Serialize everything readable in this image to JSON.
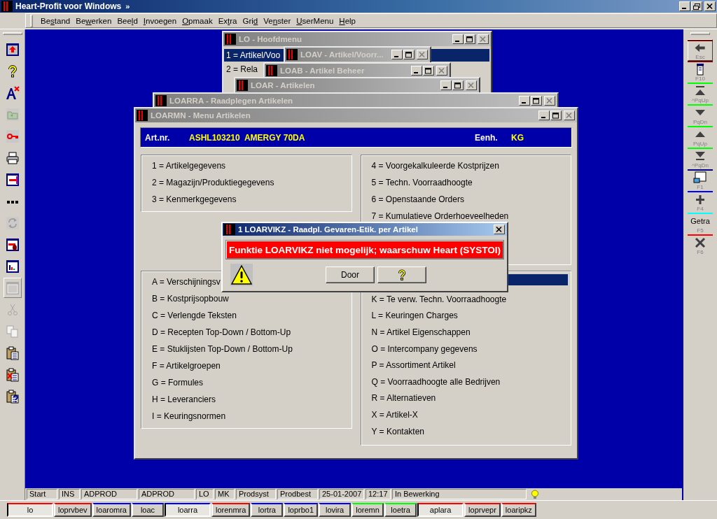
{
  "app_title": "Heart-Profit voor Windows",
  "title_chevron": "»",
  "menu": [
    {
      "before": "Be",
      "key": "s",
      "after": "tand"
    },
    {
      "before": "Be",
      "key": "w",
      "after": "erken"
    },
    {
      "before": "Bee",
      "key": "l",
      "after": "d"
    },
    {
      "key": "I",
      "after": "nvoegen"
    },
    {
      "key": "O",
      "after": "pmaak"
    },
    {
      "before": "Ex",
      "key": "t",
      "after": "ra"
    },
    {
      "before": "Gri",
      "key": "d"
    },
    {
      "before": "Ve",
      "key": "n",
      "after": "ster"
    },
    {
      "key": "U",
      "after": "serMenu"
    },
    {
      "key": "H",
      "after": "elp"
    }
  ],
  "left_toolbar": [
    {
      "kind": "window-up",
      "disabled": false
    },
    {
      "kind": "question",
      "disabled": false
    },
    {
      "kind": "font-x",
      "disabled": false
    },
    {
      "kind": "folder",
      "disabled": true
    },
    {
      "kind": "key",
      "disabled": false
    },
    {
      "kind": "printer",
      "disabled": false
    },
    {
      "kind": "window-form",
      "disabled": false
    },
    {
      "kind": "dots",
      "disabled": false
    },
    {
      "kind": "refresh",
      "disabled": true
    },
    {
      "kind": "window-mouse",
      "disabled": false
    },
    {
      "kind": "window-chart",
      "disabled": false
    },
    {
      "kind": "window-plain",
      "disabled": true
    },
    {
      "kind": "scissors",
      "disabled": true
    },
    {
      "kind": "copy",
      "disabled": true
    },
    {
      "kind": "paste",
      "disabled": false
    },
    {
      "kind": "paste-x",
      "disabled": false
    },
    {
      "kind": "paste-question",
      "disabled": false
    }
  ],
  "right_toolbar": [
    {
      "kind": "back",
      "key": "Esc",
      "color": "#800000"
    },
    {
      "kind": "printer",
      "key": "F10",
      "color": "#800000"
    },
    {
      "kind": "first",
      "key": "^PqUp",
      "color": "#00ff00"
    },
    {
      "kind": "down",
      "key": "PqDn",
      "color": "#00ff00"
    },
    {
      "kind": "up",
      "key": "PqUp",
      "color": "#00ff00"
    },
    {
      "kind": "last",
      "key": "^PqDn",
      "color": "#00ff00"
    },
    {
      "kind": "form",
      "key": "F1",
      "color": "#000080"
    },
    {
      "kind": "plus",
      "key": "F4",
      "color": "#0000ff"
    },
    {
      "kind": "text",
      "text": "Getra",
      "key": "F5",
      "color": "#00ffff"
    },
    {
      "kind": "cross",
      "key": "F6",
      "color": "#ff0000"
    }
  ],
  "windows": [
    {
      "title": "LO - Hoofdmenu",
      "items": [
        {
          "label": "1 = Artikel/Voo",
          "selected": true
        },
        {
          "label": "2 = Rela",
          "selected": false
        }
      ]
    },
    {
      "title": "LOAV - Artikel/Voorr..."
    },
    {
      "title": "LOAB - Artikel Beheer"
    },
    {
      "title": "LOAR - Artikelen"
    },
    {
      "title": "LOARRA - Raadplegen Artikelen"
    }
  ],
  "main_window": {
    "title": "LOARMN - Menu Artikelen",
    "header": {
      "article_label": "Art.nr.",
      "article": "ASHL103210  AMERGY 70DA",
      "unit_label": "Eenh.",
      "unit": "KG"
    },
    "groups": [
      {
        "selection_bar": false,
        "items": [
          "1 = Artikelgegevens",
          "2 = Magazijn/Produktiegegevens",
          "3 = Kenmerkgegevens"
        ]
      },
      {
        "selection_bar": false,
        "items": [
          "4 = Voorgekalkuleerde Kostprijzen",
          "5 = Techn. Voorraadhoogte",
          "6 = Openstaande Orders",
          "7 = Kumulatieve Orderhoeveelheden"
        ]
      },
      {
        "selection_bar": false,
        "items": [
          "A = Verschijningsv",
          "B = Kostprijsopbouw",
          "C = Verlengde Teksten",
          "D = Recepten Top-Down / Bottom-Up",
          "E = Stuklijsten Top-Down / Bottom-Up",
          "F = Artikelgroepen",
          "G = Formules",
          "H = Leveranciers",
          "I = Keuringsnormen"
        ]
      },
      {
        "selection_bar": true,
        "items": [
          "K = Te verw. Techn. Voorraadhoogte",
          "L = Keuringen Charges",
          "N = Artikel Eigenschappen",
          "O = Intercompany gegevens",
          "P = Assortiment Artikel",
          "Q = Voorraadhoogte alle Bedrijven",
          "R = Alternatieven",
          "X = Artikel-X",
          "Y = Kontakten"
        ]
      }
    ]
  },
  "dialog": {
    "title": "1 LOARVIKZ - Raadpl. Gevaren-Etik. per Artikel",
    "message": "Funktie LOARVIKZ niet mogelijk; waarschuw Heart (SYSTOI)",
    "buttons": [
      {
        "kind": "text",
        "label": "Door"
      },
      {
        "kind": "help"
      }
    ]
  },
  "status_bar": [
    "Start",
    "INS",
    "ADPROD",
    "ADPROD",
    "LO",
    "MK",
    "Prodsyst",
    "Prodbest",
    "25-01-2007",
    "12:17",
    "In Bewerking"
  ],
  "taskbar": [
    {
      "label": "lo",
      "color": "#ff0000",
      "selected": true
    },
    {
      "label": "loprvbev",
      "color": "#ff0000",
      "selected": false
    },
    {
      "label": "loaromra",
      "color": "#0000ff",
      "selected": false
    },
    {
      "label": "loac",
      "color": "#0000ff",
      "selected": false
    },
    {
      "label": "loarra",
      "color": "#0000ff",
      "selected": true
    },
    {
      "label": "lorenmra",
      "color": "#ff0000",
      "selected": false
    },
    {
      "label": "lortra",
      "color": "#0000ff",
      "selected": false
    },
    {
      "label": "loprbo1",
      "color": "#0000ff",
      "selected": false
    },
    {
      "label": "lovira",
      "color": "#0000ff",
      "selected": false
    },
    {
      "label": "loremn",
      "color": "#00ff00",
      "selected": false
    },
    {
      "label": "loetra",
      "color": "#00ff00",
      "selected": false
    },
    {
      "label": "aplara",
      "color": "#ff0000",
      "selected": true
    },
    {
      "label": "loprvepr",
      "color": "#ff0000",
      "selected": false
    },
    {
      "label": "loaripkz",
      "color": "#ff0000",
      "selected": false
    }
  ]
}
